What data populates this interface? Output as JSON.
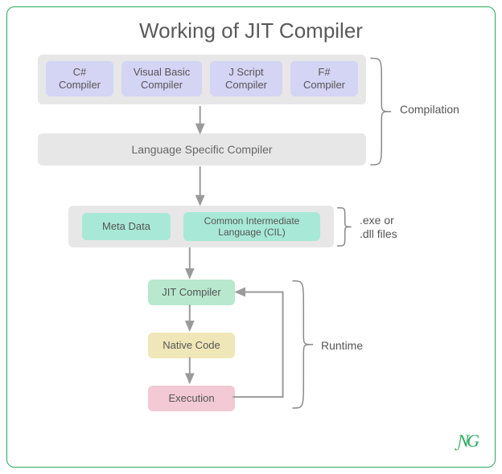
{
  "title": "Working of JIT Compiler",
  "compilers": [
    {
      "label": "C#\nCompiler"
    },
    {
      "label": "Visual Basic\nCompiler"
    },
    {
      "label": "J Script\nCompiler"
    },
    {
      "label": "F#\nCompiler"
    }
  ],
  "language_specific": "Language Specific Compiler",
  "cil_group": {
    "meta": "Meta Data",
    "cil": "Common Intermediate\nLanguage (CIL)"
  },
  "runtime_steps": {
    "jit": "JIT Compiler",
    "native": "Native Code",
    "exec": "Execution"
  },
  "annotations": {
    "compilation": "Compilation",
    "exe": ".exe or\n.dll files",
    "runtime": "Runtime"
  },
  "logo": "ƝG",
  "colors": {
    "border": "#2aa85a",
    "group": "#e7e7e7",
    "purple": "#d4d4f5",
    "teal": "#a8e8d6",
    "mint": "#b8e8cd",
    "yellow": "#f0e7b8",
    "pink": "#f2c9d5",
    "arrow": "#9a9a9a",
    "text": "#5a5a5a"
  }
}
